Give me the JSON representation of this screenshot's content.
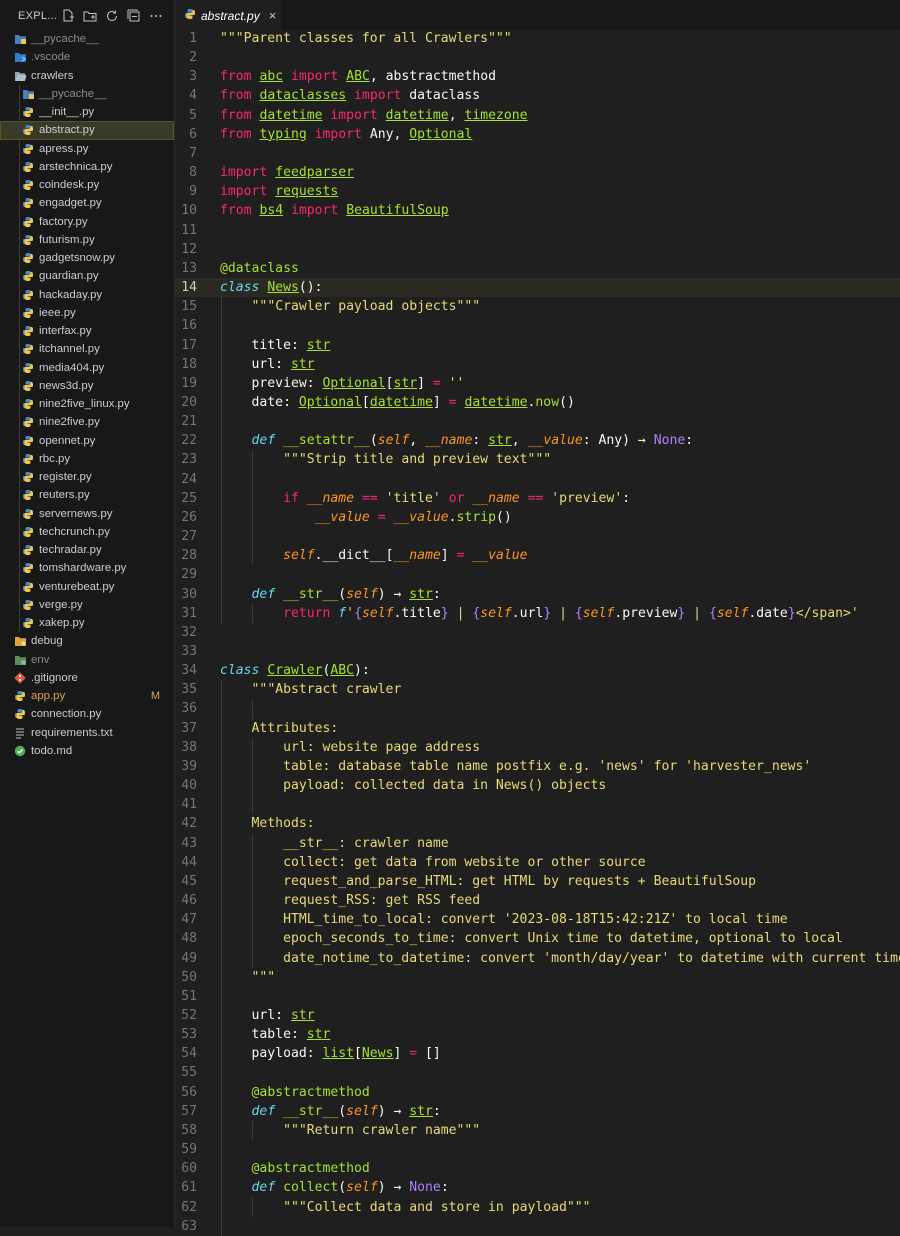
{
  "sidebar": {
    "title": "EXPL...",
    "actions": [
      "new-file-icon",
      "new-folder-icon",
      "refresh-icon",
      "collapse-icon",
      "more-icon"
    ],
    "items": [
      {
        "label": "__pycache__",
        "depth": 0,
        "icon": "folder-python",
        "dim": true
      },
      {
        "label": ".vscode",
        "depth": 0,
        "icon": "folder-vscode",
        "dim": true
      },
      {
        "label": "crawlers",
        "depth": 0,
        "icon": "folder-open"
      },
      {
        "label": "__pycache__",
        "depth": 1,
        "icon": "folder-python",
        "dim": true
      },
      {
        "label": "__init__.py",
        "depth": 1,
        "icon": "python"
      },
      {
        "label": "abstract.py",
        "depth": 1,
        "icon": "python",
        "active": true
      },
      {
        "label": "apress.py",
        "depth": 1,
        "icon": "python"
      },
      {
        "label": "arstechnica.py",
        "depth": 1,
        "icon": "python"
      },
      {
        "label": "coindesk.py",
        "depth": 1,
        "icon": "python"
      },
      {
        "label": "engadget.py",
        "depth": 1,
        "icon": "python"
      },
      {
        "label": "factory.py",
        "depth": 1,
        "icon": "python"
      },
      {
        "label": "futurism.py",
        "depth": 1,
        "icon": "python"
      },
      {
        "label": "gadgetsnow.py",
        "depth": 1,
        "icon": "python"
      },
      {
        "label": "guardian.py",
        "depth": 1,
        "icon": "python"
      },
      {
        "label": "hackaday.py",
        "depth": 1,
        "icon": "python"
      },
      {
        "label": "ieee.py",
        "depth": 1,
        "icon": "python"
      },
      {
        "label": "interfax.py",
        "depth": 1,
        "icon": "python"
      },
      {
        "label": "itchannel.py",
        "depth": 1,
        "icon": "python"
      },
      {
        "label": "media404.py",
        "depth": 1,
        "icon": "python"
      },
      {
        "label": "news3d.py",
        "depth": 1,
        "icon": "python"
      },
      {
        "label": "nine2five_linux.py",
        "depth": 1,
        "icon": "python"
      },
      {
        "label": "nine2five.py",
        "depth": 1,
        "icon": "python"
      },
      {
        "label": "opennet.py",
        "depth": 1,
        "icon": "python"
      },
      {
        "label": "rbc.py",
        "depth": 1,
        "icon": "python"
      },
      {
        "label": "register.py",
        "depth": 1,
        "icon": "python"
      },
      {
        "label": "reuters.py",
        "depth": 1,
        "icon": "python"
      },
      {
        "label": "servernews.py",
        "depth": 1,
        "icon": "python"
      },
      {
        "label": "techcrunch.py",
        "depth": 1,
        "icon": "python"
      },
      {
        "label": "techradar.py",
        "depth": 1,
        "icon": "python"
      },
      {
        "label": "tomshardware.py",
        "depth": 1,
        "icon": "python"
      },
      {
        "label": "venturebeat.py",
        "depth": 1,
        "icon": "python"
      },
      {
        "label": "verge.py",
        "depth": 1,
        "icon": "python"
      },
      {
        "label": "xakep.py",
        "depth": 1,
        "icon": "python"
      },
      {
        "label": "debug",
        "depth": 0,
        "icon": "folder-debug"
      },
      {
        "label": "env",
        "depth": 0,
        "icon": "folder-env",
        "dim": true
      },
      {
        "label": ".gitignore",
        "depth": 0,
        "icon": "git"
      },
      {
        "label": "app.py",
        "depth": 0,
        "icon": "python",
        "badge": "M",
        "color": "#d6a44c"
      },
      {
        "label": "connection.py",
        "depth": 0,
        "icon": "python"
      },
      {
        "label": "requirements.txt",
        "depth": 0,
        "icon": "text"
      },
      {
        "label": "todo.md",
        "depth": 0,
        "icon": "todo"
      }
    ]
  },
  "tab": {
    "label": "abstract.py",
    "close": "×"
  },
  "editor": {
    "current_line": 14,
    "lines": [
      "\"\"\"Parent classes for all Crawlers\"\"\"",
      "",
      "from abc import ABC, abstractmethod",
      "from dataclasses import dataclass",
      "from datetime import datetime, timezone",
      "from typing import Any, Optional",
      "",
      "import feedparser",
      "import requests",
      "from bs4 import BeautifulSoup",
      "",
      "",
      "@dataclass",
      "class News():",
      "    \"\"\"Crawler payload objects\"\"\"",
      "",
      "    title: str",
      "    url: str",
      "    preview: Optional[str] = ''",
      "    date: Optional[datetime] = datetime.now()",
      "",
      "    def __setattr__(self, __name: str, __value: Any) → None:",
      "        \"\"\"Strip title and preview text\"\"\"",
      "",
      "        if __name == 'title' or __name == 'preview':",
      "            __value = __value.strip()",
      "",
      "        self.__dict__[__name] = __value",
      "",
      "    def __str__(self) → str:",
      "        return f'{self.title} | {self.url} | {self.preview} | {self.date}'",
      "",
      "",
      "class Crawler(ABC):",
      "    \"\"\"Abstract crawler",
      "",
      "    Attributes:",
      "        url: website page address",
      "        table: database table name postfix e.g. 'news' for 'harvester_news'",
      "        payload: collected data in News() objects",
      "",
      "    Methods:",
      "        __str__: crawler name",
      "        collect: get data from website or other source",
      "        request_and_parse_HTML: get HTML by requests + BeautifulSoup",
      "        request_RSS: get RSS feed",
      "        HTML_time_to_local: convert '2023-08-18T15:42:21Z' to local time",
      "        epoch_seconds_to_time: convert Unix time to datetime, optional to local",
      "        date_notime_to_datetime: convert 'month/day/year' to datetime with current time",
      "    \"\"\"",
      "",
      "    url: str",
      "    table: str",
      "    payload: list[News] = []",
      "",
      "    @abstractmethod",
      "    def __str__(self) → str:",
      "        \"\"\"Return crawler name\"\"\"",
      "",
      "    @abstractmethod",
      "    def collect(self) → None:",
      "        \"\"\"Collect data and store in payload\"\"\"",
      ""
    ]
  },
  "colors": {
    "keyword": "#f92672",
    "storage": "#66d9ef",
    "class": "#a6e22e",
    "string": "#e6db74",
    "param": "#fd971f",
    "constant": "#ae81ff",
    "text": "#f8f8f2",
    "python_icon": "#4b8bbe"
  }
}
